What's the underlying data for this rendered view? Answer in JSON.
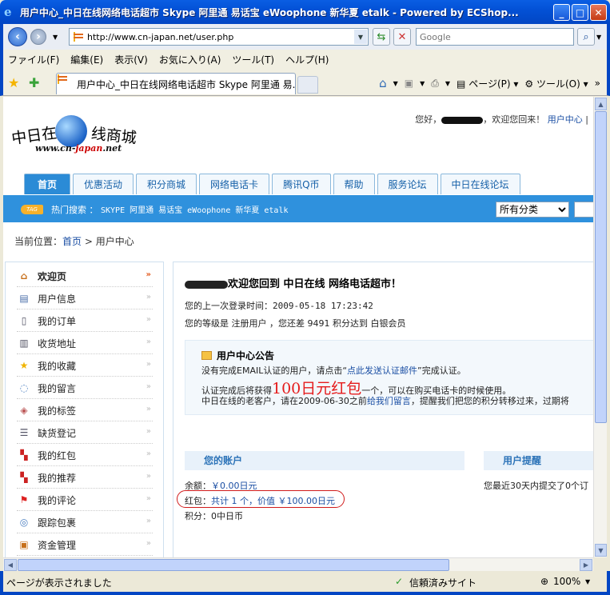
{
  "window": {
    "title": "用户中心_中日在线网络电话超市 Skype 阿里通 易话宝 eWoophone 新华夏 etalk - Powered by ECShop...",
    "min": "_",
    "max": "□",
    "close": "✕"
  },
  "address": {
    "url": "http://www.cn-japan.net/user.php",
    "search_placeholder": "Google"
  },
  "menu": [
    "ファイル(F)",
    "編集(E)",
    "表示(V)",
    "お気に入り(A)",
    "ツール(T)",
    "ヘルプ(H)"
  ],
  "tab": {
    "label": "用户中心_中日在线网络电话超市 Skype 阿里通 易..."
  },
  "tools": {
    "page": "ページ(P)",
    "tool": "ツール(O)",
    "more": "»"
  },
  "icons": {
    "back": "back-arrow-icon",
    "forward": "forward-arrow-icon",
    "refresh": "refresh-icon",
    "stop": "stop-icon",
    "search": "search-icon",
    "home": "home-icon",
    "feed": "feed-icon",
    "print": "print-icon"
  },
  "colors": {
    "accent": "#2f91dd",
    "highlight": "#d01b1b",
    "link": "#1a4ea3"
  },
  "site": {
    "logo_left": "中日在",
    "logo_right": "线商城",
    "logo_url_a": "www.cn-",
    "logo_url_b": "japan",
    "logo_url_c": ".net",
    "greeting_prefix": "您好，",
    "greeting_suffix": "，欢迎您回来！",
    "user_center_link": "用户中心",
    "separator": "|"
  },
  "nav": [
    "首页",
    "优惠活动",
    "积分商城",
    "网络电话卡",
    "腾讯Q币",
    "帮助",
    "服务论坛",
    "中日在线论坛"
  ],
  "hotsearch": {
    "tag": "TAG",
    "label": "热门搜索 ：",
    "keywords": "SKYPE 阿里通 易话宝 eWoophone 新华夏 etalk",
    "category": "所有分类"
  },
  "breadcrumb": {
    "label": "当前位置：",
    "home": "首页",
    "sep": " > ",
    "current": "用户中心"
  },
  "sidebar": {
    "items": [
      {
        "label": "欢迎页",
        "icon": "home-icon"
      },
      {
        "label": "用户信息",
        "icon": "id-card-icon"
      },
      {
        "label": "我的订单",
        "icon": "document-icon"
      },
      {
        "label": "收货地址",
        "icon": "address-book-icon"
      },
      {
        "label": "我的收藏",
        "icon": "star-icon"
      },
      {
        "label": "我的留言",
        "icon": "speech-bubble-icon"
      },
      {
        "label": "我的标签",
        "icon": "tag-icon"
      },
      {
        "label": "缺货登记",
        "icon": "checklist-icon"
      },
      {
        "label": "我的红包",
        "icon": "red-packet-icon"
      },
      {
        "label": "我的推荐",
        "icon": "recommend-icon"
      },
      {
        "label": "我的评论",
        "icon": "flag-icon"
      },
      {
        "label": "跟踪包裹",
        "icon": "package-icon"
      },
      {
        "label": "资金管理",
        "icon": "wallet-icon"
      }
    ]
  },
  "main": {
    "welcome": "欢迎您回到 中日在线 网络电话超市！",
    "last_login_label": "您的上一次登录时间：",
    "last_login": "2009-05-18 17:23:42",
    "level_text_a": "您的等级是 注册用户 ，您还差 ",
    "level_points": "9491",
    "level_text_b": " 积分达到 白银会员",
    "notice": {
      "title": "用户中心公告",
      "line1_a": "没有完成EMAIL认证的用户，请点击“",
      "line1_link": "点此发送认证邮件",
      "line1_b": "”完成认证。",
      "line2_a": "认证完成后将获得",
      "line2_big": "100日元红包",
      "line2_b": "一个，可以在购买电话卡的时候使用。",
      "line3_a": "中日在线的老客户，请在2009-06-30之前",
      "line3_link": "给我们留言",
      "line3_b": "，提醒我们把您的积分转移过来，过期将"
    },
    "account": {
      "title": "您的账户",
      "balance_label": "余额：",
      "balance": "￥0.00日元",
      "bonus_label": "红包：",
      "bonus": "共计 1 个，价值 ￥100.00日元",
      "points": "积分：0中日币"
    },
    "reminder": {
      "title": "用户提醒",
      "text": "您最近30天内提交了0个订"
    }
  },
  "status": {
    "left": "ページが表示されました",
    "trust": "信頼済みサイト",
    "zoom": "100%"
  }
}
